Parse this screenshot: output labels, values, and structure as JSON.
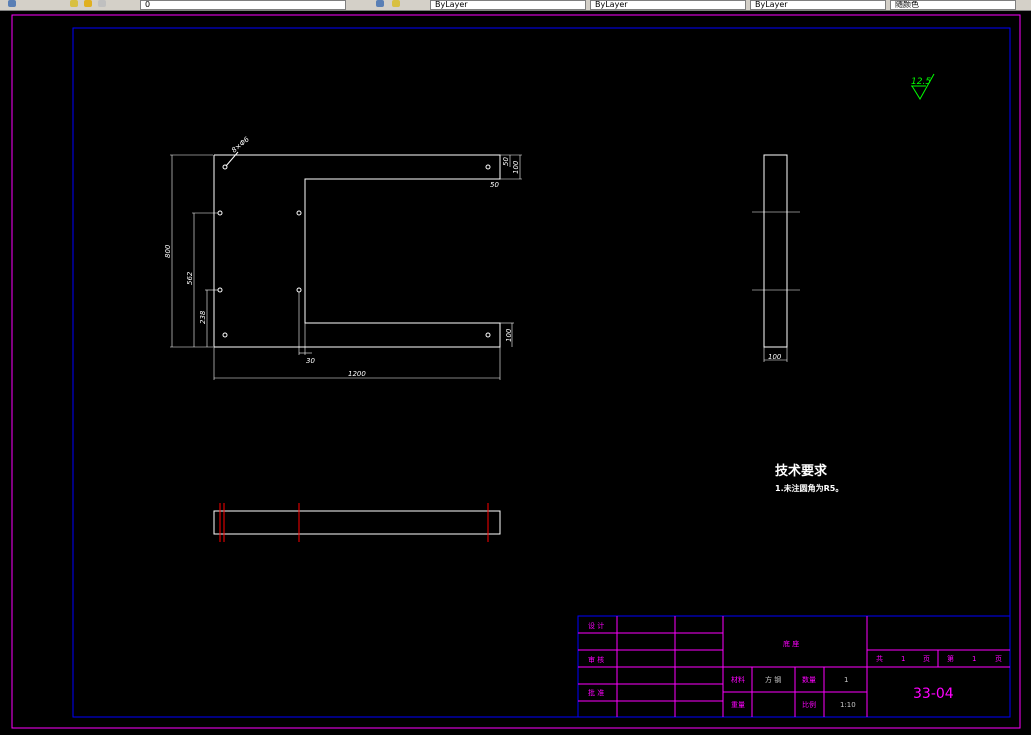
{
  "toolbar": {
    "layer_label": "0",
    "linetype_1": "ByLayer",
    "linetype_2": "ByLayer",
    "linetype_3": "ByLayer",
    "color_label": "随颜色"
  },
  "drawing": {
    "dimensions": {
      "hole_note": "8×Φ6",
      "dim_50_top": "50",
      "dim_100_right_top": "100",
      "dim_50_inner": "50",
      "dim_800": "800",
      "dim_562": "562",
      "dim_238": "238",
      "dim_100_right_bottom": "100",
      "dim_30": "30",
      "dim_1200": "1200",
      "dim_100_side": "100"
    },
    "roughness": "12.5",
    "tech_requirements_title": "技术要求",
    "tech_requirements_item": "1.未注圆角为R5。"
  },
  "title_block": {
    "design_label": "设 计",
    "check_label": "审 核",
    "approve_label": "批 准",
    "part_name": "底 座",
    "material_label": "材料",
    "material_value": "方 钢",
    "quantity_label": "数量",
    "quantity_value": "1",
    "weight_label": "重量",
    "scale_label": "比例",
    "scale_value": "1:10",
    "total_label": "共",
    "total_value": "1",
    "sheet_label": "页",
    "page_label": "第",
    "page_value": "1",
    "page_unit": "页",
    "drawing_number": "33-04"
  },
  "colors": {
    "background": "#000000",
    "frame": "#ff00ff",
    "inner_frame": "#0000ff",
    "geometry": "#ffffff",
    "center_lines": "#ff0000",
    "roughness_symbol": "#00ff00"
  }
}
